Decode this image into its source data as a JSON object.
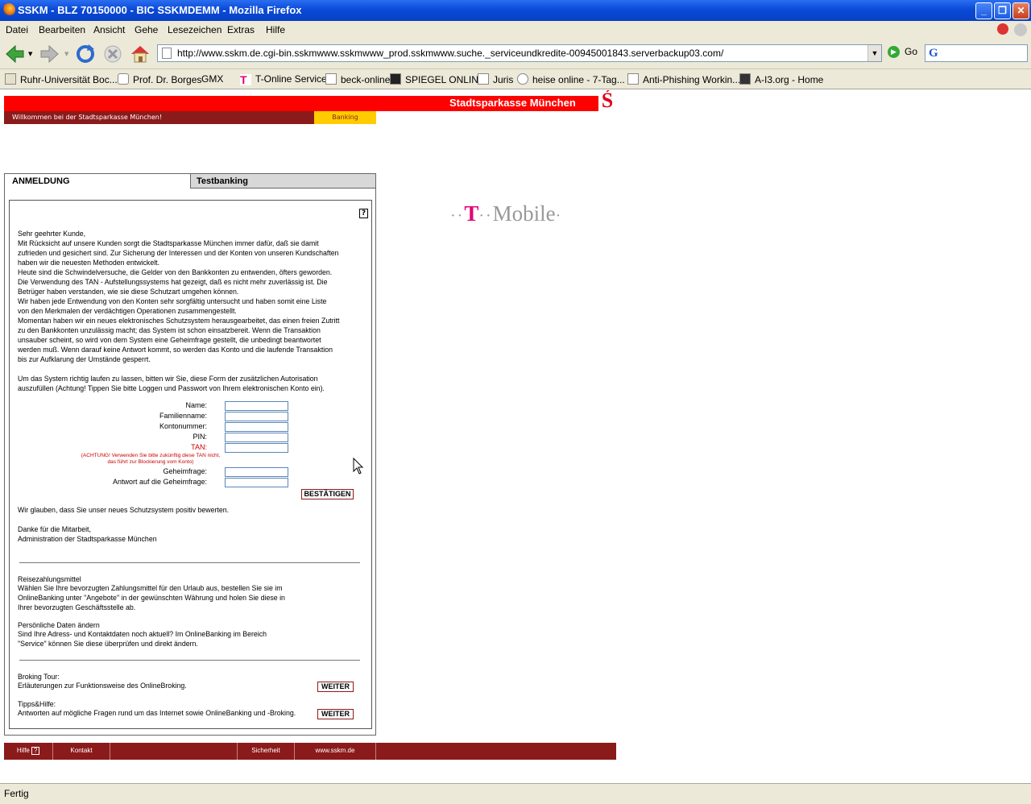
{
  "window": {
    "title": "SSKM - BLZ 70150000 - BIC SSKMDEMM - Mozilla Firefox"
  },
  "menu": [
    "Datei",
    "Bearbeiten",
    "Ansicht",
    "Gehe",
    "Lesezeichen",
    "Extras",
    "Hilfe"
  ],
  "address": {
    "url": "http://www.sskm.de.cgi-bin.sskmwww.sskmwww_prod.sskmwww.suche._serviceundkredite-00945001843.serverbackup03.com/",
    "go_label": "Go"
  },
  "bookmarks": [
    "Ruhr-Universität Boc...",
    "Prof. Dr. Borges",
    "GMX",
    "T-Online Service",
    "beck-online",
    "SPIEGEL ONLINE",
    "Juris",
    "heise online - 7-Tag...",
    "Anti-Phishing Workin...",
    "A-I3.org - Home"
  ],
  "status": "Fertig",
  "site": {
    "brand": "Stadtsparkasse München",
    "logo_glyph": "Ś",
    "welcome": "Willkommen bei der Stadtsparkasse München!",
    "banking_tab": "Banking",
    "tabs": [
      "ANMELDUNG",
      "Testbanking"
    ],
    "help_glyph": "?",
    "intro_lines": [
      "Sehr geehrter Kunde,",
      "Mit Rücksicht auf unsere Kunden sorgt die Stadtsparkasse München immer dafür, daß sie damit",
      "zufrieden und gesichert sind. Zur Sicherung der Interessen und der Konten von unseren Kundschaften",
      "haben wir die neuesten Methoden entwickelt.",
      "Heute sind die Schwindelversuche, die Gelder von den Bankkonten zu entwenden, öfters geworden.",
      "Die Verwendung des TAN - Aufstellungssystems hat gezeigt, daß es nicht mehr zuverlässig ist. Die",
      "Betrüger haben verstanden, wie sie diese Schutzart umgehen können.",
      "Wir haben jede Entwendung von den Konten sehr sorgfältig untersucht und haben somit eine Liste",
      "von den Merkmalen der verdächtigen Operationen zusammengestellt.",
      "Momentan haben wir ein neues elektronisches Schutzsystem herausgearbeitet, das einen freien Zutritt",
      "zu den Bankkonten unzulässig macht; das System ist schon einsatzbereit. Wenn die Transaktion",
      "unsauber scheint, so wird von dem System eine Geheimfrage gestellt, die unbedingt beantwortet",
      "werden muß. Wenn darauf keine Antwort kommt, so werden das Konto und die laufende Transaktion",
      "bis zur Aufklarung der Umstände gesperrt."
    ],
    "instruction_lines": [
      "Um das System richtig laufen zu lassen, bitten wir Sie, diese Form der zusätzlichen Autorisation",
      "auszufüllen (Achtung! Tippen Sie bitte Loggen und Passwort von Ihrem elektronischen Konto ein)."
    ],
    "form": {
      "name_label": "Name:",
      "surname_label": "Familienname:",
      "account_label": "Kontonummer:",
      "pin_label": "PIN:",
      "tan_label": "TAN:",
      "tan_warning": "(ACHTUNG! Verwenden Sie bitte zukünftig diese TAN nicht, das führt zur Blockierung vom Konto)",
      "question_label": "Geheimfrage:",
      "answer_label": "Antwort auf die Geheimfrage:",
      "submit_label": "BESTÄTIGEN"
    },
    "closing_lines": [
      "Wir glauben, dass Sie unser neues Schutzsystem positiv bewerten.",
      "",
      "Danke für die Mitarbeit,",
      "Administration der Stadtsparkasse München"
    ],
    "travel": {
      "title": "Reisezahlungsmittel",
      "lines": [
        "Wählen Sie Ihre bevorzugten Zahlungsmittel für den Urlaub aus, bestellen Sie sie im",
        "OnlineBanking unter \"Angebote\" in der gewünschten Währung und holen Sie diese in",
        "Ihrer bevorzugten Geschäftsstelle ab."
      ]
    },
    "personal": {
      "title": "Persönliche Daten ändern",
      "lines": [
        "Sind Ihre Adress- und Kontaktdaten noch aktuell? Im OnlineBanking im Bereich",
        "\"Service\" können Sie diese überprüfen und direkt ändern."
      ]
    },
    "broking": {
      "title": "Broking Tour:",
      "text": "Erläuterungen zur Funktionsweise des OnlineBroking.",
      "button": "WEITER"
    },
    "tips": {
      "title": "Tipps&Hilfe:",
      "text": "Antworten auf mögliche Fragen rund um das Internet sowie OnlineBanking und -Broking.",
      "button": "WEITER"
    },
    "ad": {
      "brand_t": "T",
      "brand_rest": "Mobile"
    },
    "footer": [
      "Hilfe",
      "Kontakt",
      "Sicherheit",
      "www.sskm.de"
    ]
  },
  "colors": {
    "brand_red": "#ff0000",
    "dark_red": "#8b1a1a",
    "banking_yellow": "#ffcc00",
    "xp_blue": "#0a4ad8",
    "tmobile_magenta": "#e20074"
  }
}
